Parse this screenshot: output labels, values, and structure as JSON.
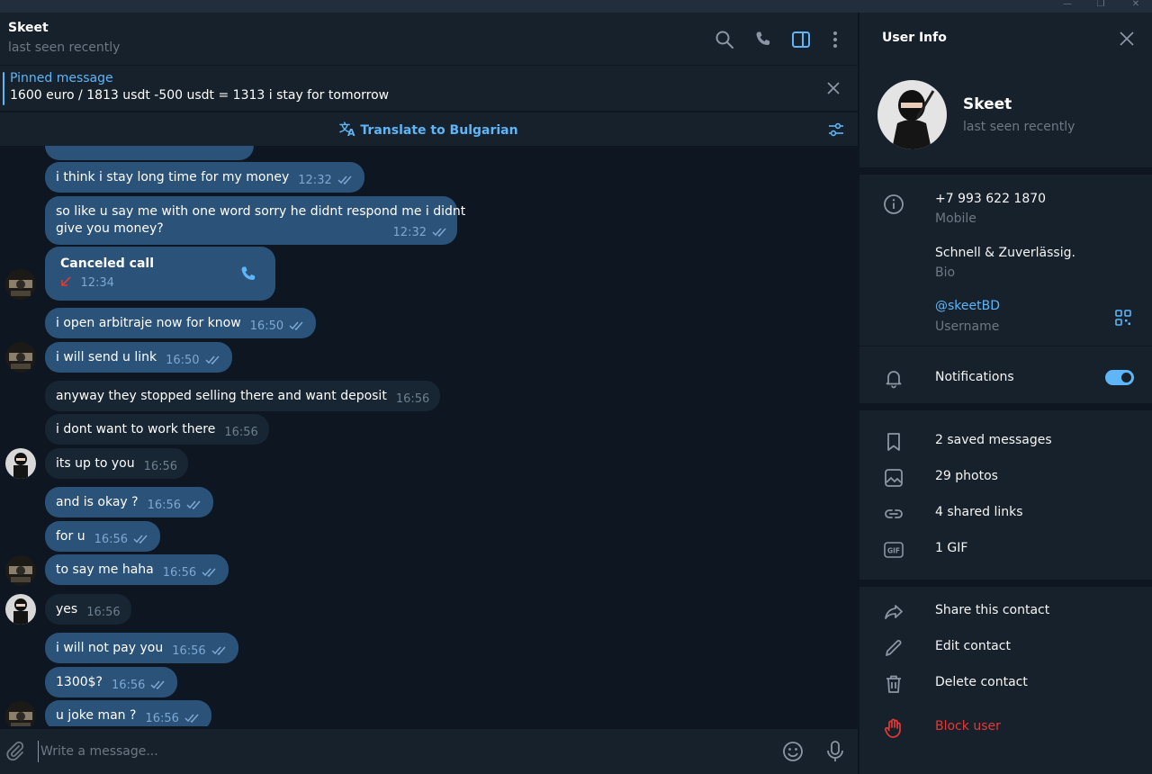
{
  "window": {
    "minimize": "—",
    "maximize": "❐",
    "close": "✕"
  },
  "chat": {
    "name": "Skeet",
    "status": "last seen recently",
    "pinned": {
      "title": "Pinned message",
      "text": "1600 euro / 1813 usdt -500 usdt = 1313 i stay for tomorrow"
    },
    "translate_label": "Translate to Bulgarian",
    "messages": [
      {
        "dir": "out",
        "text": "i think i stay long time for my money",
        "time": "12:32"
      },
      {
        "dir": "out",
        "text": "so like u say me with one word sorry he didnt respond me i didnt",
        "text2": "give you money?",
        "time": "12:32"
      },
      {
        "dir": "in",
        "title": "Canceled call",
        "time": "12:34"
      },
      {
        "dir": "out",
        "text": "i open arbitraje now for know",
        "time": "16:50"
      },
      {
        "dir": "out",
        "text": "i will send u link",
        "time": "16:50"
      },
      {
        "dir": "in",
        "text": "anyway they stopped selling there and want deposit",
        "time": "16:56"
      },
      {
        "dir": "in",
        "text": "i dont want to work there",
        "time": "16:56"
      },
      {
        "dir": "in",
        "text": "its up to you",
        "time": "16:56"
      },
      {
        "dir": "out",
        "text": "and is okay ?",
        "time": "16:56"
      },
      {
        "dir": "out",
        "text": "for u",
        "time": "16:56"
      },
      {
        "dir": "out",
        "text": "to say me haha",
        "time": "16:56"
      },
      {
        "dir": "in",
        "text": "yes",
        "time": "16:56"
      },
      {
        "dir": "out",
        "text": "i will not pay you",
        "time": "16:56"
      },
      {
        "dir": "out",
        "text": "1300$?",
        "time": "16:56"
      },
      {
        "dir": "out",
        "text": "u joke man ?",
        "time": "16:56"
      }
    ],
    "composer_placeholder": "Write a message..."
  },
  "info": {
    "header": "User Info",
    "name": "Skeet",
    "status": "last seen recently",
    "phone": "+7 993 622 1870",
    "phone_label": "Mobile",
    "bio": "Schnell & Zuverlässig.",
    "bio_label": "Bio",
    "username": "@skeetBD",
    "username_label": "Username",
    "notifications": "Notifications",
    "notifications_on": true,
    "media": {
      "saved": "2 saved messages",
      "photos": "29 photos",
      "links": "4 shared links",
      "gif": "1 GIF"
    },
    "actions": {
      "share": "Share this contact",
      "edit": "Edit contact",
      "delete": "Delete contact",
      "block": "Block user"
    }
  },
  "colors": {
    "accent": "#5eb5f7",
    "outgoing_bubble": "#2b5278",
    "incoming_bubble": "#182533",
    "danger": "#e53935",
    "background": "#0e1621",
    "panel": "#17212b"
  }
}
